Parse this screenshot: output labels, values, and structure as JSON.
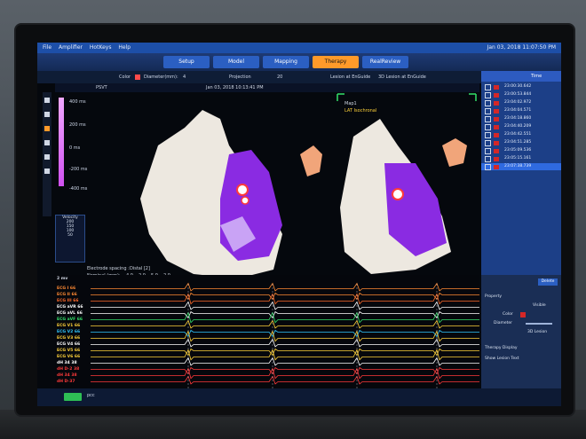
{
  "menu": {
    "items": [
      "File",
      "Amplifier",
      "HotKeys",
      "Help"
    ],
    "clock": "Jan 03, 2018 11:07:50 PM"
  },
  "tabs": [
    {
      "label": "Setup",
      "active": false
    },
    {
      "label": "Model",
      "active": false
    },
    {
      "label": "Mapping",
      "active": false
    },
    {
      "label": "Therapy",
      "active": true
    },
    {
      "label": "RealReview",
      "active": false
    }
  ],
  "toolbar": {
    "color_label": "Color",
    "diameter_label": "Diameter(mm):",
    "diameter_value": "4",
    "projection_label": "Projection",
    "projection_value": "20",
    "lesion_label": "Lesion at EnGuide",
    "lesion3d_label": "3D Lesion at EnGuide"
  },
  "map": {
    "rhythm": "PSVT",
    "timestamp": "Jan 03, 2018 10:13:41 PM",
    "map_name": "Map1",
    "map_type": "LAT Isochronal",
    "scale_ticks": [
      "400 ms",
      "200 ms",
      "0 ms",
      "-200 ms",
      "-400 ms"
    ],
    "electrode_spacing_label": "Electrode spacing :",
    "electrode_spacing_value": "Distal [2]",
    "nominal_label": "Nominal (mm):",
    "nominal_values": [
      "4.0",
      "2.0",
      "5.0",
      "2.0"
    ]
  },
  "velocity": {
    "label": "Velocity",
    "values": [
      "200",
      "150",
      "100",
      "50"
    ]
  },
  "lesions": {
    "header_time": "Time",
    "rows": [
      {
        "time": "23:00:30.642",
        "selected": false
      },
      {
        "time": "23:00:53.844",
        "selected": false
      },
      {
        "time": "23:04:02.972",
        "selected": false
      },
      {
        "time": "23:04:04.571",
        "selected": false
      },
      {
        "time": "23:04:18.860",
        "selected": false
      },
      {
        "time": "23:04:40.209",
        "selected": false
      },
      {
        "time": "23:04:42.551",
        "selected": false
      },
      {
        "time": "23:04:51.285",
        "selected": false
      },
      {
        "time": "23:05:09.536",
        "selected": false
      },
      {
        "time": "23:05:15.161",
        "selected": false
      },
      {
        "time": "23:07:38.739",
        "selected": true
      }
    ]
  },
  "properties": {
    "title": "Property",
    "visible_label": "Visible",
    "color_label": "Color",
    "diameter_label": "Diameter",
    "lesion3d_label": "3D Lesion",
    "therapy_display": "Therapy Display",
    "show_lesion_text": "Show Lesion Text",
    "delete_label": "Delete"
  },
  "ecg": {
    "speed": "2 mv",
    "channels": [
      {
        "label": "ECG I 66",
        "color": "#ff8a33"
      },
      {
        "label": "ECG II 66",
        "color": "#ff8a33"
      },
      {
        "label": "ECG III 66",
        "color": "#ff6a2a"
      },
      {
        "label": "ECG aVR 66",
        "color": "#ffffff"
      },
      {
        "label": "ECG aVL 66",
        "color": "#ffffff"
      },
      {
        "label": "ECG aVF 66",
        "color": "#33e06a"
      },
      {
        "label": "ECG V1 66",
        "color": "#ffd23a"
      },
      {
        "label": "ECG V2 66",
        "color": "#33c8ff"
      },
      {
        "label": "ECG V3 66",
        "color": "#ffd23a"
      },
      {
        "label": "ECG V4 66",
        "color": "#ffffff"
      },
      {
        "label": "ECG V5 66",
        "color": "#ffd23a"
      },
      {
        "label": "ECG V6 66",
        "color": "#ffd23a"
      },
      {
        "label": "dH 34 38",
        "color": "#ffffff"
      },
      {
        "label": "dH D-2 38",
        "color": "#ff3a3a"
      },
      {
        "label": "dH 34 38",
        "color": "#ff3a3a"
      },
      {
        "label": "dH D-37",
        "color": "#ff3a3a"
      }
    ]
  },
  "footer": {
    "label": "pcc"
  },
  "colors": {
    "accent_orange": "#ff9a2a",
    "menu_blue": "#1d4fa8",
    "lesion_red": "#d42727",
    "map_purple": "#8a2be2"
  }
}
